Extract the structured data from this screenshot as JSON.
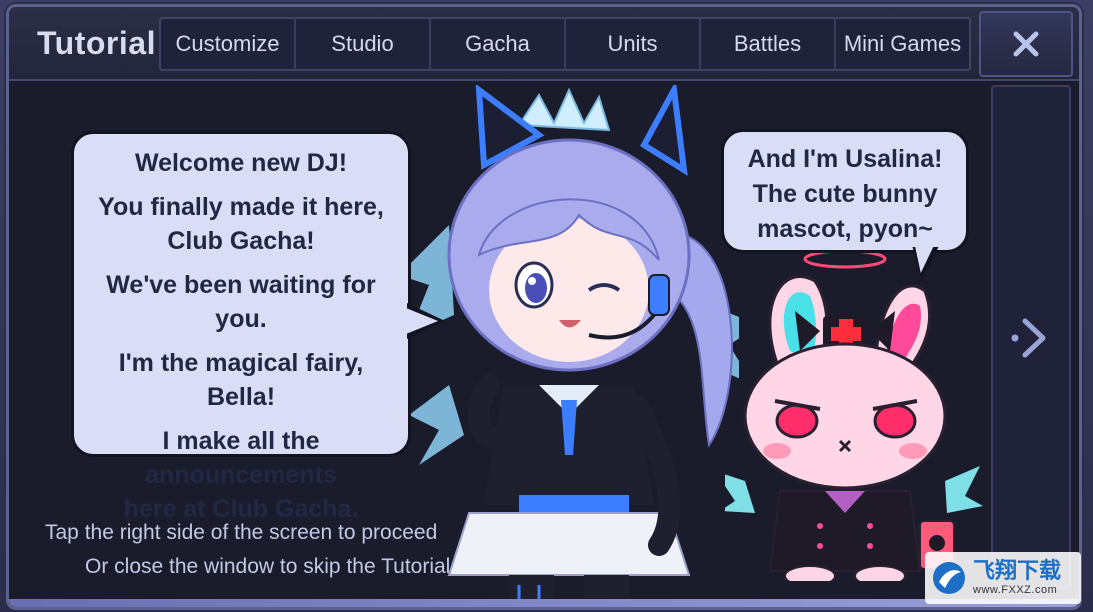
{
  "header": {
    "title": "Tutorial",
    "tabs": [
      {
        "label": "Customize"
      },
      {
        "label": "Studio"
      },
      {
        "label": "Gacha"
      },
      {
        "label": "Units"
      },
      {
        "label": "Battles"
      },
      {
        "label": "Mini Games"
      }
    ],
    "close_icon": "close-x-icon"
  },
  "dialog": {
    "bella": {
      "lines": [
        "Welcome new DJ!",
        "You finally made it here,",
        "Club Gacha!",
        "We've been waiting for you.",
        "I'm the magical fairy, Bella!",
        "I make all the announcements",
        "here at Club Gacha."
      ]
    },
    "usalina": {
      "lines": [
        "And I'm Usalina!",
        "The cute bunny",
        "mascot, pyon~"
      ]
    }
  },
  "hints": {
    "proceed": "Tap the right side of the screen to proceed",
    "skip": "Or close the window to skip the Tutorial"
  },
  "navigation": {
    "next_icon": "chevron-right-icon"
  },
  "watermark": {
    "main": "飞翔下载",
    "sub": "www.FXXZ.com"
  },
  "colors": {
    "bubble_fill": "#d9def6",
    "bubble_text": "#222744",
    "panel_bg": "#1a1c2c",
    "accent_blue": "#3d7dff"
  }
}
